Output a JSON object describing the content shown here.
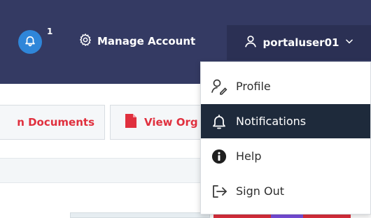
{
  "header": {
    "notification_count": "1",
    "manage_account_label": "Manage Account",
    "username": "portaluser01",
    "colors": {
      "bar": "#343a63",
      "user_menu": "#2b3054",
      "bell_badge": "#2f86d9"
    }
  },
  "toolbar": {
    "buttons": [
      {
        "label": "n Documents",
        "color": "#e0303e"
      },
      {
        "label": "View Org",
        "icon": "file-icon",
        "color": "#e0303e"
      }
    ]
  },
  "user_dropdown": {
    "items": [
      {
        "label": "Profile",
        "icon": "profile-icon"
      },
      {
        "label": "Notifications",
        "icon": "bell-icon",
        "active": true
      },
      {
        "label": "Help",
        "icon": "info-icon"
      },
      {
        "label": "Sign Out",
        "icon": "sign-out-icon"
      }
    ],
    "colors": {
      "active_bg": "#1e2a3b"
    }
  }
}
